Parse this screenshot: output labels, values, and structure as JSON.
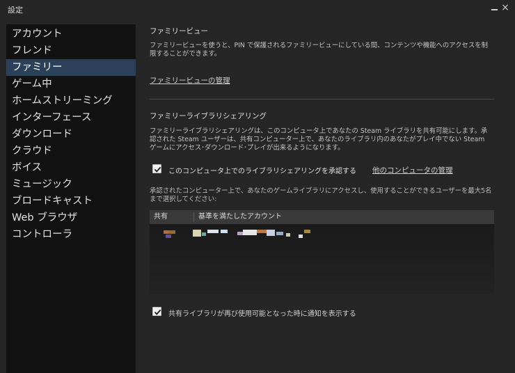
{
  "window": {
    "title": "設定",
    "minimize_label": "_",
    "close_label": "×"
  },
  "sidebar": {
    "items": [
      {
        "label": "アカウント"
      },
      {
        "label": "フレンド"
      },
      {
        "label": "ファミリー",
        "selected": true
      },
      {
        "label": "ゲーム中"
      },
      {
        "label": "ホームストリーミング"
      },
      {
        "label": "インターフェース"
      },
      {
        "label": "ダウンロード"
      },
      {
        "label": "クラウド"
      },
      {
        "label": "ボイス"
      },
      {
        "label": "ミュージック"
      },
      {
        "label": "ブロードキャスト"
      },
      {
        "label": "Web ブラウザ"
      },
      {
        "label": "コントローラ"
      }
    ]
  },
  "family_view": {
    "heading": "ファミリービュー",
    "description": "ファミリービューを使うと、PIN で保護されるファミリービューにしている間、コンテンツや機能へのアクセスを制限することができます。",
    "manage_link": "ファミリービューの管理"
  },
  "library_sharing": {
    "heading": "ファミリーライブラリシェアリング",
    "description": "ファミリーライブラリシェアリングは、このコンピュータ上であなたの Steam ライブラリを共有可能にします。承認された Steam ユーザーは、共有コンピューター上で、あなたのライブラリ内のあなたがプレイ中でない Steam ゲームにアクセス･ダウンロード･プレイが出来るようになります。",
    "authorize_checkbox": {
      "label": "このコンピュータ上でのライブラリシェアリングを承認する",
      "checked": true
    },
    "other_computers_link": "他のコンピュータの管理",
    "authorized_note": "承認されたコンピューター上で、あなたのゲームライブラリにアクセスし、使用することができるユーザーを最大5名まで選択してください:",
    "table": {
      "columns": [
        "共有",
        "基準を満たしたアカウント"
      ],
      "rows": [
        {
          "shared": "",
          "account": ""
        }
      ]
    },
    "notify_checkbox": {
      "label": "共有ライブラリが再び使用可能となった時に通知を表示する",
      "checked": true
    }
  },
  "colors": {
    "selected_item": "#2b4159",
    "sidebar_bg": "#121212",
    "window_bg": "#262626"
  }
}
